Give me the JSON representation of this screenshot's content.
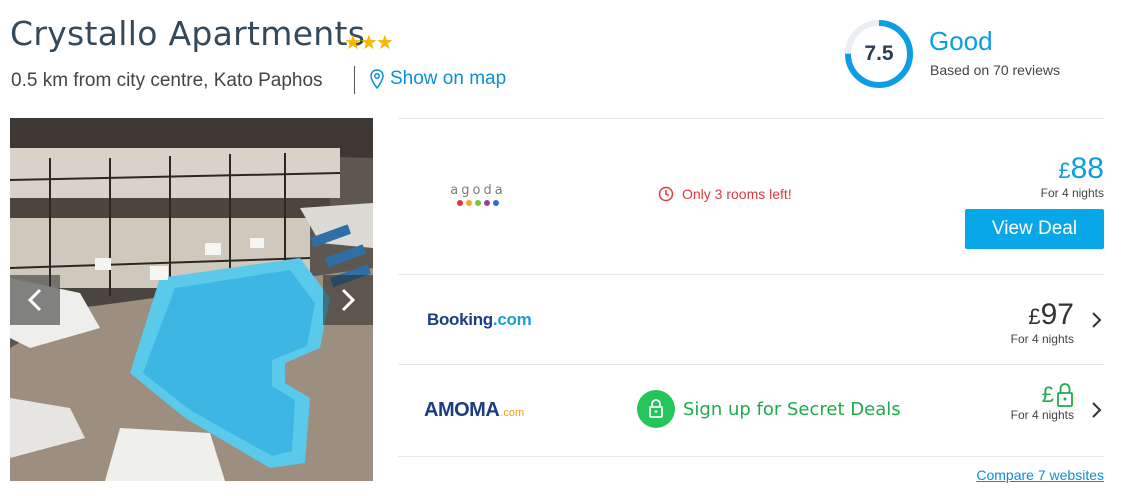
{
  "hotel": {
    "name": "Crystallo Apartments",
    "stars": "★★★",
    "location": "0.5 km from city centre, Kato Paphos",
    "map_link": "Show on map"
  },
  "rating": {
    "score": "7.5",
    "score_fraction": 0.75,
    "label": "Good",
    "reviews": "Based on 70 reviews",
    "accent": "#0b9ee5"
  },
  "deals": [
    {
      "provider": "agoda",
      "urgency": "Only 3 rooms left!",
      "currency": "£",
      "price": "88",
      "nights": "For 4 nights",
      "cta": "View Deal"
    },
    {
      "provider": "Booking",
      "provider_suffix": ".com",
      "currency": "£",
      "price": "97",
      "nights": "For 4 nights"
    },
    {
      "provider": "AMOMA",
      "provider_suffix": ".com",
      "promo": "Sign up for Secret Deals",
      "currency": "£",
      "nights": "For 4 nights"
    }
  ],
  "compare_link": "Compare 7 websites",
  "colors": {
    "link": "#0b8fd8",
    "cta": "#08a7e8",
    "urgent": "#e0393e",
    "secret": "#24c55a",
    "star": "#f7b600"
  },
  "icons": {
    "map": "map-pin-icon",
    "clock": "clock-icon",
    "lock": "lock-icon",
    "prev": "chevron-left-icon",
    "next": "chevron-right-icon"
  }
}
